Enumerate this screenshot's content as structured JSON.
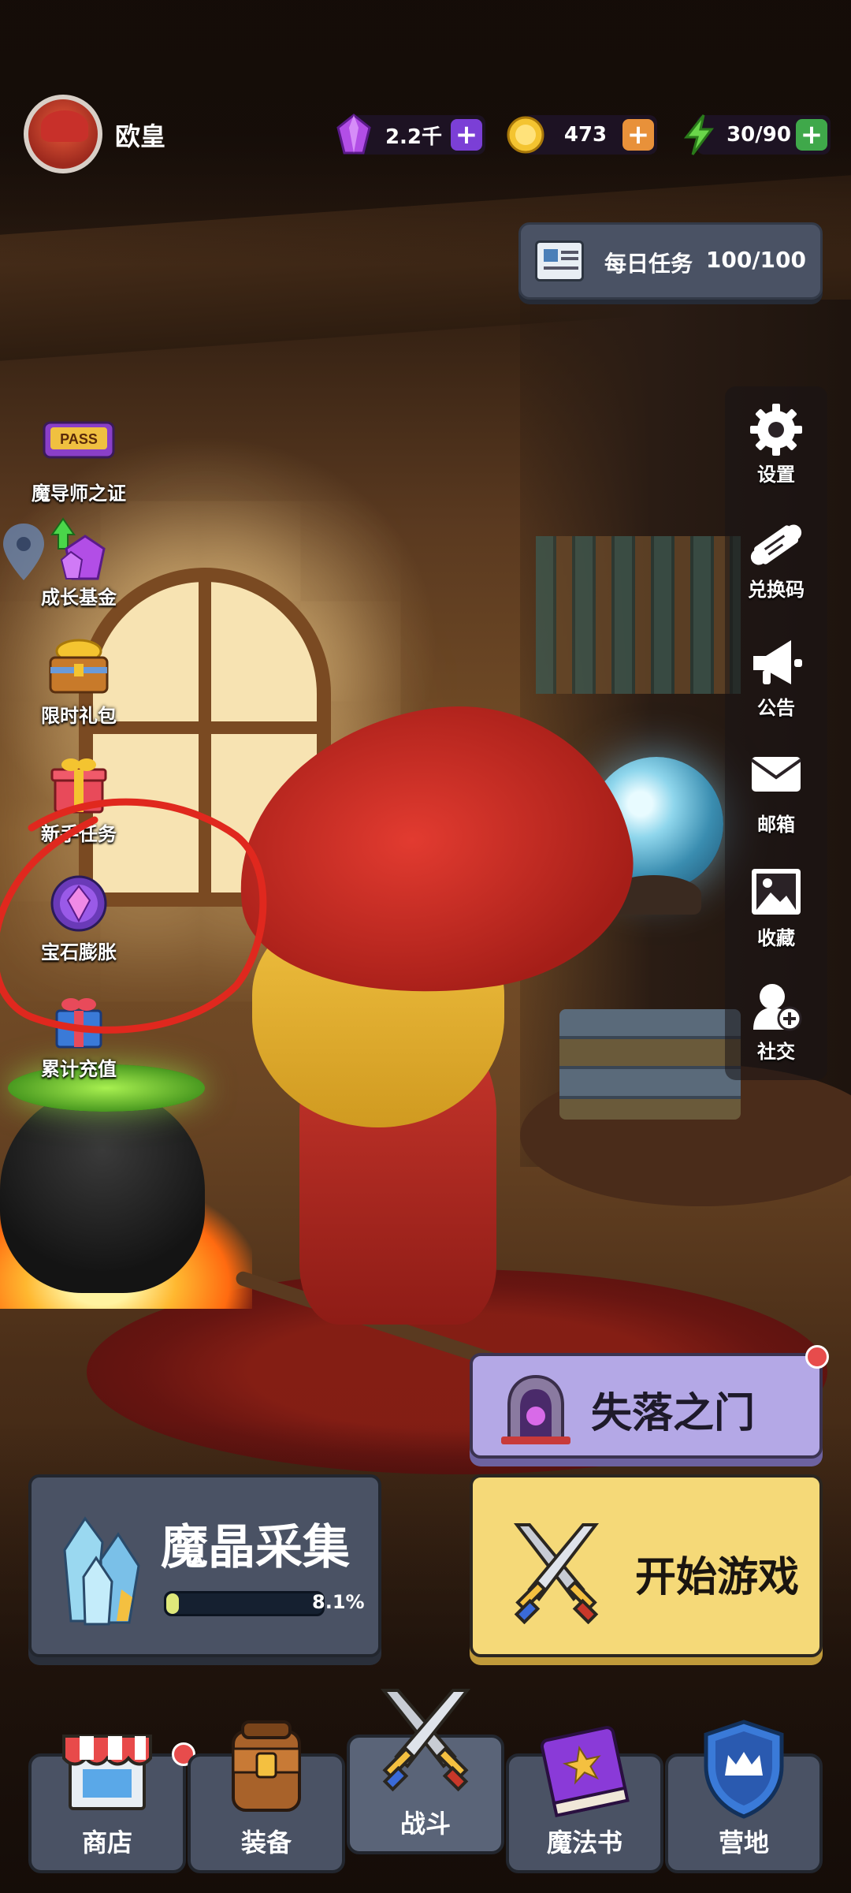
{
  "user": {
    "name": "欧皇"
  },
  "resources": [
    {
      "name": "gems",
      "value": "2.2千",
      "icon": "purple-gem-icon",
      "plus_color": "#7b3fd6"
    },
    {
      "name": "coins",
      "value": "473",
      "icon": "gold-coin-icon",
      "plus_color": "#e8913a"
    },
    {
      "name": "energy",
      "value": "30/90",
      "icon": "lightning-icon",
      "plus_color": "#3fa84a"
    }
  ],
  "daily_task": {
    "label": "每日任务",
    "progress": "100/100"
  },
  "left_menu": [
    {
      "label": "魔导师之证",
      "icon": "pass-ticket-icon",
      "icon_text": "PASS"
    },
    {
      "label": "成长基金",
      "icon": "growth-gem-icon"
    },
    {
      "label": "限时礼包",
      "icon": "treasure-chest-icon"
    },
    {
      "label": "新手任务",
      "icon": "gift-box-icon"
    },
    {
      "label": "宝石膨胀",
      "icon": "gem-expand-icon"
    },
    {
      "label": "累计充值",
      "icon": "gift-icon"
    }
  ],
  "right_menu": [
    {
      "label": "设置",
      "icon": "gear-icon"
    },
    {
      "label": "兑换码",
      "icon": "scroll-icon"
    },
    {
      "label": "公告",
      "icon": "megaphone-icon"
    },
    {
      "label": "邮箱",
      "icon": "mail-icon"
    },
    {
      "label": "收藏",
      "icon": "image-icon"
    },
    {
      "label": "社交",
      "icon": "add-friend-icon"
    }
  ],
  "buttons": {
    "lost_gate": "失落之门",
    "crystal_collect": {
      "title": "魔晶采集",
      "progress": 0.081,
      "progress_text": "8.1%"
    },
    "start_game": "开始游戏"
  },
  "nav": [
    {
      "label": "商店",
      "icon": "shop-icon",
      "badge": true
    },
    {
      "label": "装备",
      "icon": "backpack-icon",
      "badge": false
    },
    {
      "label": "战斗",
      "icon": "crossed-swords-icon",
      "badge": false,
      "active": true
    },
    {
      "label": "魔法书",
      "icon": "spellbook-icon",
      "badge": false
    },
    {
      "label": "营地",
      "icon": "shield-crown-icon",
      "badge": false
    }
  ],
  "colors": {
    "panel": "#4a5264",
    "start": "#f5d978",
    "gate": "#b4a8e6",
    "badge": "#e74c4c"
  }
}
